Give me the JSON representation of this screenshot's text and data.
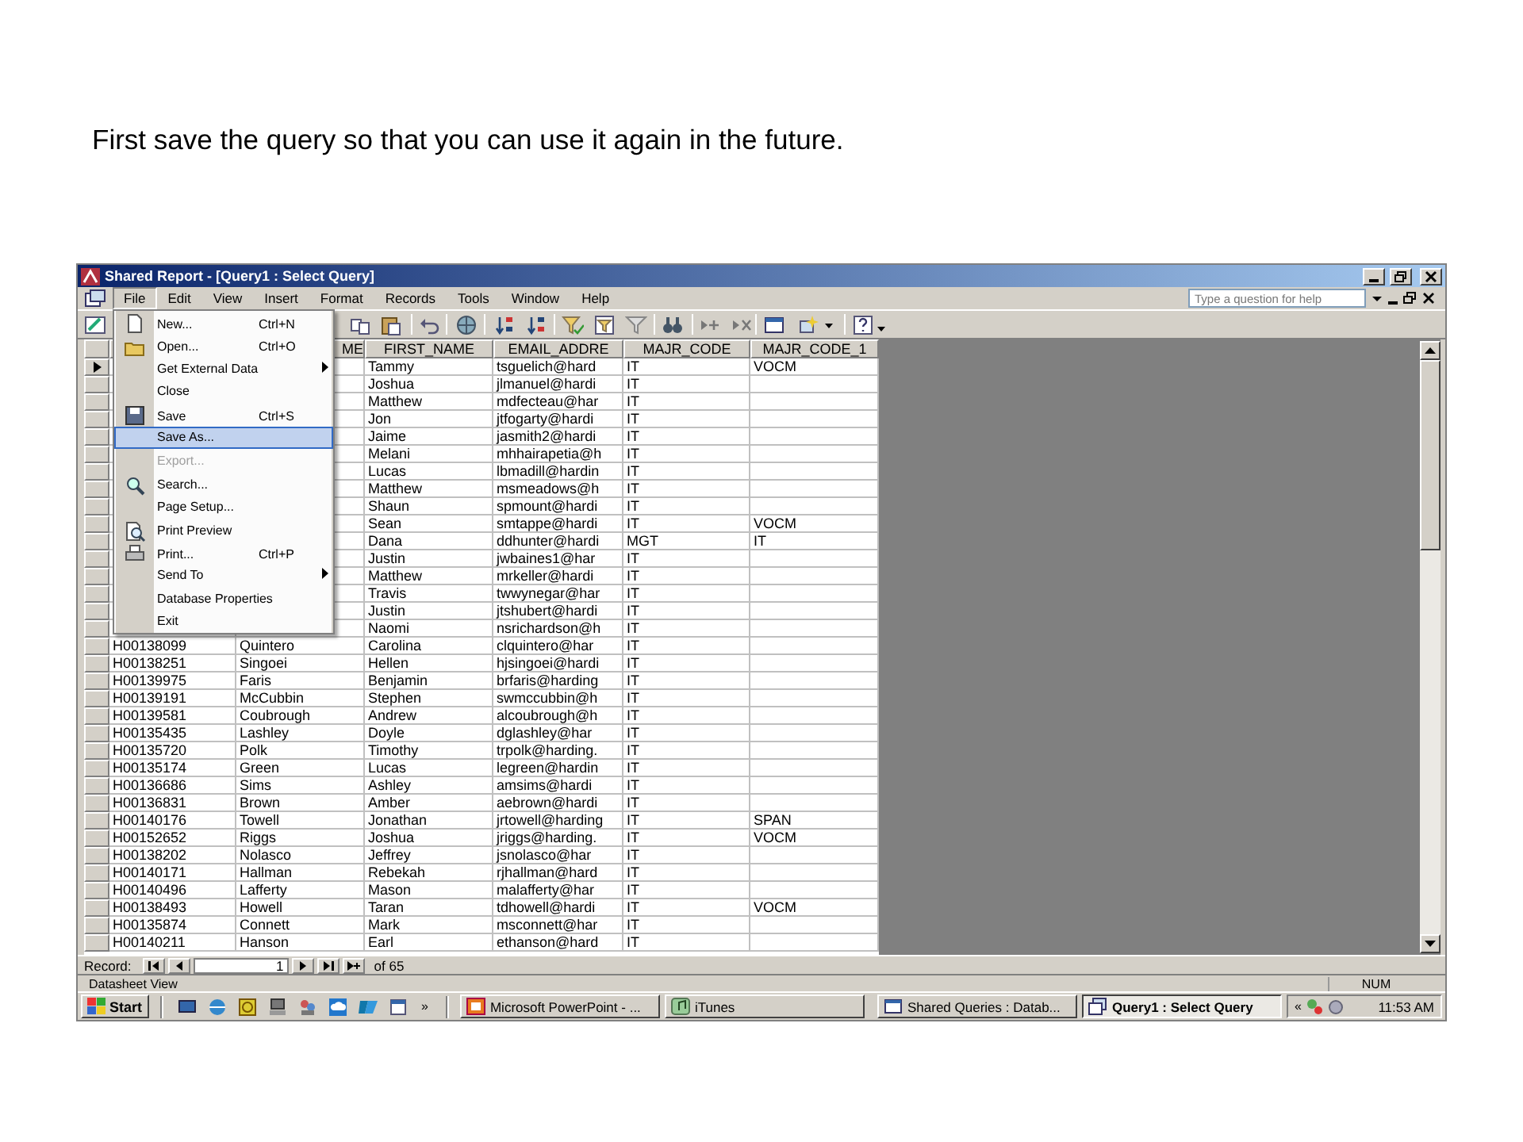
{
  "caption": "First save the query so that you can use it again in the future.",
  "window": {
    "title": "Shared Report - [Query1 : Select Query]"
  },
  "menu_bar": {
    "items": [
      {
        "label": "File",
        "selected": true
      },
      {
        "label": "Edit",
        "selected": false
      },
      {
        "label": "View",
        "selected": false
      },
      {
        "label": "Insert",
        "selected": false
      },
      {
        "label": "Format",
        "selected": false
      },
      {
        "label": "Records",
        "selected": false
      },
      {
        "label": "Tools",
        "selected": false
      },
      {
        "label": "Window",
        "selected": false
      },
      {
        "label": "Help",
        "selected": false
      }
    ],
    "help_box": {
      "placeholder": "Type a question for help"
    }
  },
  "file_menu": {
    "items": [
      {
        "label": "New...",
        "shortcut": "Ctrl+N",
        "kind": "new",
        "submenu": false,
        "selected": false,
        "disabled": false
      },
      {
        "label": "Open...",
        "shortcut": "Ctrl+O",
        "kind": "open",
        "submenu": false,
        "selected": false,
        "disabled": false
      },
      {
        "label": "Get External Data",
        "submenu": true,
        "selected": false,
        "disabled": false
      },
      {
        "label": "Close",
        "submenu": false,
        "selected": false,
        "disabled": false
      },
      {
        "label": "Save",
        "shortcut": "Ctrl+S",
        "kind": "save",
        "submenu": false,
        "selected": false,
        "disabled": false
      },
      {
        "label": "Save As...",
        "submenu": false,
        "selected": true,
        "disabled": false
      },
      {
        "label": "Export...",
        "submenu": false,
        "selected": false,
        "disabled": true
      },
      {
        "label": "Search...",
        "kind": "search",
        "submenu": false,
        "selected": false,
        "disabled": false
      },
      {
        "label": "Page Setup...",
        "submenu": false,
        "selected": false,
        "disabled": false
      },
      {
        "label": "Print Preview",
        "kind": "preview",
        "submenu": false,
        "selected": false,
        "disabled": false
      },
      {
        "label": "Print...",
        "shortcut": "Ctrl+P",
        "kind": "print",
        "submenu": false,
        "selected": false,
        "disabled": false
      },
      {
        "label": "Send To",
        "submenu": true,
        "selected": false,
        "disabled": false
      },
      {
        "label": "Database Properties",
        "submenu": false,
        "selected": false,
        "disabled": false
      },
      {
        "label": "Exit",
        "submenu": false,
        "selected": false,
        "disabled": false
      }
    ]
  },
  "table": {
    "columns": [
      "ME",
      "FIRST_NAME",
      "EMAIL_ADDRE",
      "MAJR_CODE",
      "MAJR_CODE_1"
    ],
    "rows": [
      {
        "selected": true,
        "first_name": "Tammy",
        "email": "tsguelich@hard",
        "majr_code": "IT",
        "majr_code_1": "VOCM"
      },
      {
        "selected": false,
        "first_name": "Joshua",
        "email": "jlmanuel@hardi",
        "majr_code": "IT"
      },
      {
        "selected": false,
        "first_name": "Matthew",
        "email": "mdfecteau@har",
        "majr_code": "IT"
      },
      {
        "selected": false,
        "first_name": "Jon",
        "email": "jtfogarty@hardi",
        "majr_code": "IT"
      },
      {
        "selected": false,
        "first_name": "Jaime",
        "email": "jasmith2@hardi",
        "majr_code": "IT"
      },
      {
        "selected": false,
        "first_name": "Melani",
        "email": "mhhairapetia@h",
        "majr_code": "IT"
      },
      {
        "selected": false,
        "first_name": "Lucas",
        "email": "lbmadill@hardin",
        "majr_code": "IT"
      },
      {
        "selected": false,
        "first_name": "Matthew",
        "email": "msmeadows@h",
        "majr_code": "IT"
      },
      {
        "selected": false,
        "first_name": "Shaun",
        "email": "spmount@hardi",
        "majr_code": "IT"
      },
      {
        "selected": false,
        "first_name": "Sean",
        "email": "smtappe@hardi",
        "majr_code": "IT",
        "majr_code_1": "VOCM"
      },
      {
        "selected": false,
        "first_name": "Dana",
        "email": "ddhunter@hardi",
        "majr_code": "MGT",
        "majr_code_1": "IT"
      },
      {
        "selected": false,
        "first_name": "Justin",
        "email": "jwbaines1@har",
        "majr_code": "IT"
      },
      {
        "selected": false,
        "first_name": "Matthew",
        "email": "mrkeller@hardi",
        "majr_code": "IT"
      },
      {
        "selected": false,
        "first_name": "Travis",
        "email": "twwynegar@har",
        "majr_code": "IT"
      },
      {
        "selected": false,
        "first_name": "Justin",
        "email": "jtshubert@hardi",
        "majr_code": "IT"
      },
      {
        "selected": false,
        "first_name": "Naomi",
        "email": "nsrichardson@h",
        "majr_code": "IT"
      },
      {
        "selected": false,
        "column_1": "H00138099",
        "column_2": "Quintero",
        "first_name": "Carolina",
        "email": "clquintero@har",
        "majr_code": "IT"
      },
      {
        "selected": false,
        "column_1": "H00138251",
        "column_2": "Singoei",
        "first_name": "Hellen",
        "email": "hjsingoei@hardi",
        "majr_code": "IT"
      },
      {
        "selected": false,
        "column_1": "H00139975",
        "column_2": "Faris",
        "first_name": "Benjamin",
        "email": "brfaris@harding",
        "majr_code": "IT"
      },
      {
        "selected": false,
        "column_1": "H00139191",
        "column_2": "McCubbin",
        "first_name": "Stephen",
        "email": "swmccubbin@h",
        "majr_code": "IT"
      },
      {
        "selected": false,
        "column_1": "H00139581",
        "column_2": "Coubrough",
        "first_name": "Andrew",
        "email": "alcoubrough@h",
        "majr_code": "IT"
      },
      {
        "selected": false,
        "column_1": "H00135435",
        "column_2": "Lashley",
        "first_name": "Doyle",
        "email": "dglashley@har",
        "majr_code": "IT"
      },
      {
        "selected": false,
        "column_1": "H00135720",
        "column_2": "Polk",
        "first_name": "Timothy",
        "email": "trpolk@harding.",
        "majr_code": "IT"
      },
      {
        "selected": false,
        "column_1": "H00135174",
        "column_2": "Green",
        "first_name": "Lucas",
        "email": "legreen@hardin",
        "majr_code": "IT"
      },
      {
        "selected": false,
        "column_1": "H00136686",
        "column_2": "Sims",
        "first_name": "Ashley",
        "email": "amsims@hardi",
        "majr_code": "IT"
      },
      {
        "selected": false,
        "column_1": "H00136831",
        "column_2": "Brown",
        "first_name": "Amber",
        "email": "aebrown@hardi",
        "majr_code": "IT"
      },
      {
        "selected": false,
        "column_1": "H00140176",
        "column_2": "Towell",
        "first_name": "Jonathan",
        "email": "jrtowell@harding",
        "majr_code": "IT",
        "majr_code_1": "SPAN"
      },
      {
        "selected": false,
        "column_1": "H00152652",
        "column_2": "Riggs",
        "first_name": "Joshua",
        "email": "jriggs@harding.",
        "majr_code": "IT",
        "majr_code_1": "VOCM"
      },
      {
        "selected": false,
        "column_1": "H00138202",
        "column_2": "Nolasco",
        "first_name": "Jeffrey",
        "email": "jsnolasco@har",
        "majr_code": "IT"
      },
      {
        "selected": false,
        "column_1": "H00140171",
        "column_2": "Hallman",
        "first_name": "Rebekah",
        "email": "rjhallman@hard",
        "majr_code": "IT"
      },
      {
        "selected": false,
        "column_1": "H00140496",
        "column_2": "Lafferty",
        "first_name": "Mason",
        "email": "malafferty@har",
        "majr_code": "IT"
      },
      {
        "selected": false,
        "column_1": "H00138493",
        "column_2": "Howell",
        "first_name": "Taran",
        "email": "tdhowell@hardi",
        "majr_code": "IT",
        "majr_code_1": "VOCM"
      },
      {
        "selected": false,
        "column_1": "H00135874",
        "column_2": "Connett",
        "first_name": "Mark",
        "email": "msconnett@har",
        "majr_code": "IT"
      },
      {
        "selected": false,
        "column_1": "H00140211",
        "column_2": "Hanson",
        "first_name": "Earl",
        "email": "ethanson@hard",
        "majr_code": "IT"
      }
    ]
  },
  "record_nav": {
    "label": "Record:",
    "value": "1",
    "total": "of 65"
  },
  "status_bar": {
    "text": "Datasheet View",
    "indicator": "NUM"
  },
  "taskbar": {
    "start": "Start",
    "more": "»",
    "tasks": [
      {
        "label": "Microsoft PowerPoint - ...",
        "kind": "slides",
        "selected": false
      },
      {
        "label": "iTunes",
        "kind": "music",
        "selected": false
      },
      {
        "label": "Shared Queries : Datab...",
        "kind": "database",
        "selected": false
      },
      {
        "label": "Query1 : Select Query",
        "kind": "query",
        "selected": true
      }
    ],
    "tray_expand": "«",
    "clock": "11:53 AM"
  }
}
